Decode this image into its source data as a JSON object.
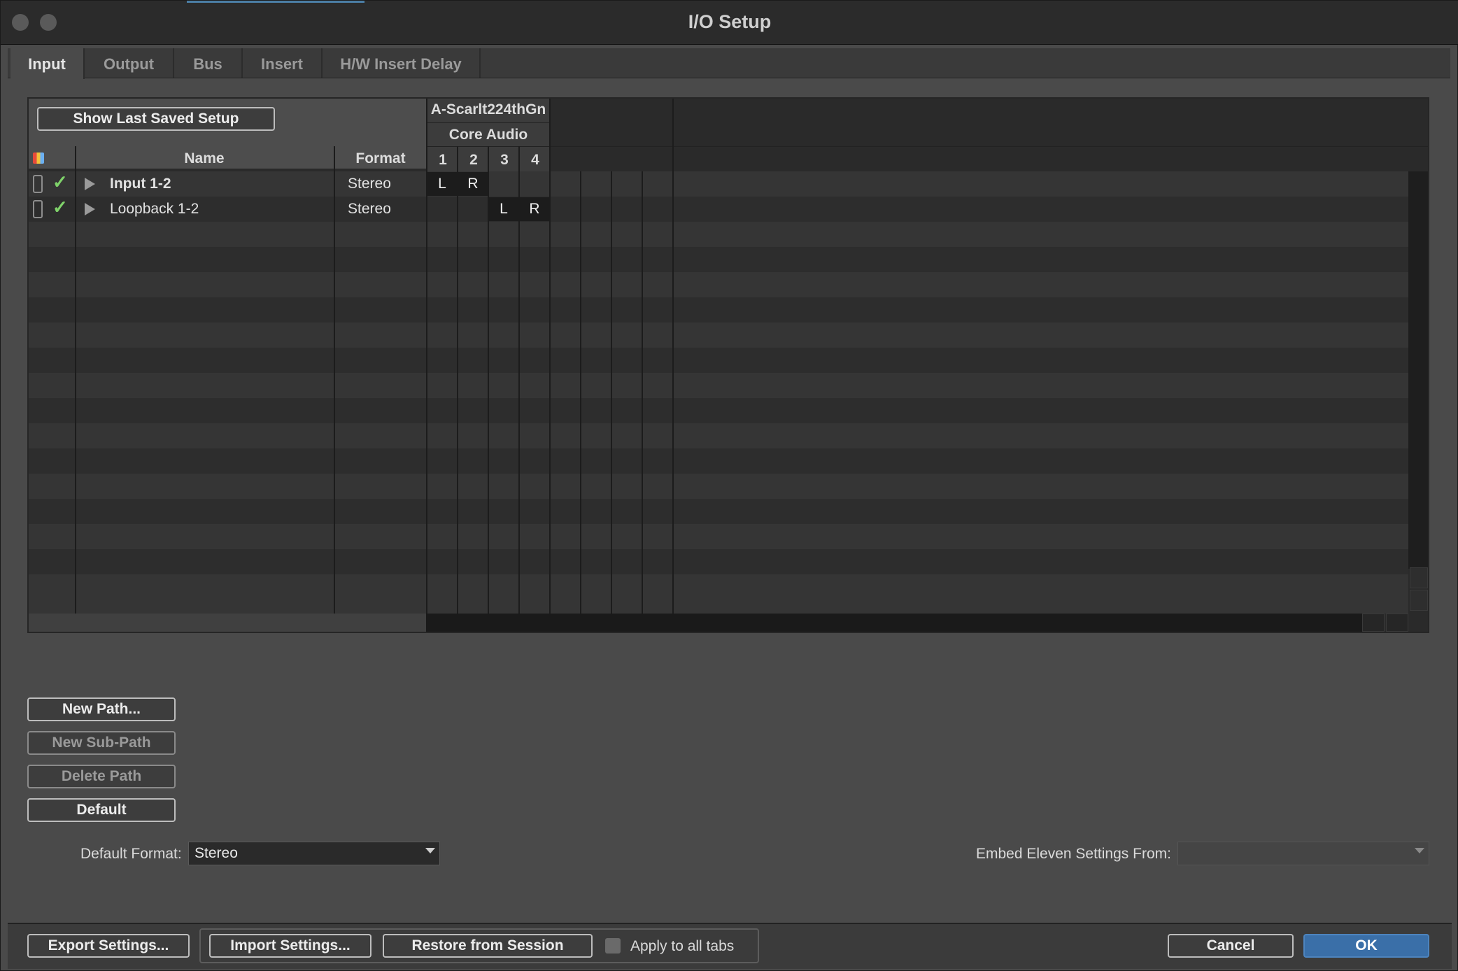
{
  "window": {
    "title": "I/O Setup"
  },
  "tabs": [
    {
      "label": "Input",
      "active": true
    },
    {
      "label": "Output",
      "active": false
    },
    {
      "label": "Bus",
      "active": false
    },
    {
      "label": "Insert",
      "active": false
    },
    {
      "label": "H/W Insert Delay",
      "active": false
    }
  ],
  "grid": {
    "show_last_saved_label": "Show Last Saved Setup",
    "device": "A-Scarlt224thGn",
    "driver": "Core Audio",
    "col_name": "Name",
    "col_format": "Format",
    "channels": [
      "1",
      "2",
      "3",
      "4"
    ],
    "paths": [
      {
        "name": "Input 1-2",
        "format": "Stereo",
        "active": true,
        "bold": true,
        "assign": [
          "L",
          "R",
          "",
          ""
        ]
      },
      {
        "name": "Loopback 1-2",
        "format": "Stereo",
        "active": true,
        "bold": false,
        "assign": [
          "",
          "",
          "L",
          "R"
        ]
      }
    ]
  },
  "actions": {
    "new_path": "New Path...",
    "new_sub_path": "New Sub-Path",
    "delete_path": "Delete Path",
    "default": "Default"
  },
  "default_format": {
    "label": "Default Format:",
    "value": "Stereo"
  },
  "embed": {
    "label": "Embed Eleven Settings From:",
    "value": ""
  },
  "footer": {
    "export": "Export Settings...",
    "import": "Import Settings...",
    "restore": "Restore from Session",
    "apply_all": "Apply to all tabs",
    "cancel": "Cancel",
    "ok": "OK"
  },
  "colors": {
    "ok_button": "#3a6fa8",
    "check": "#7fd36a"
  }
}
